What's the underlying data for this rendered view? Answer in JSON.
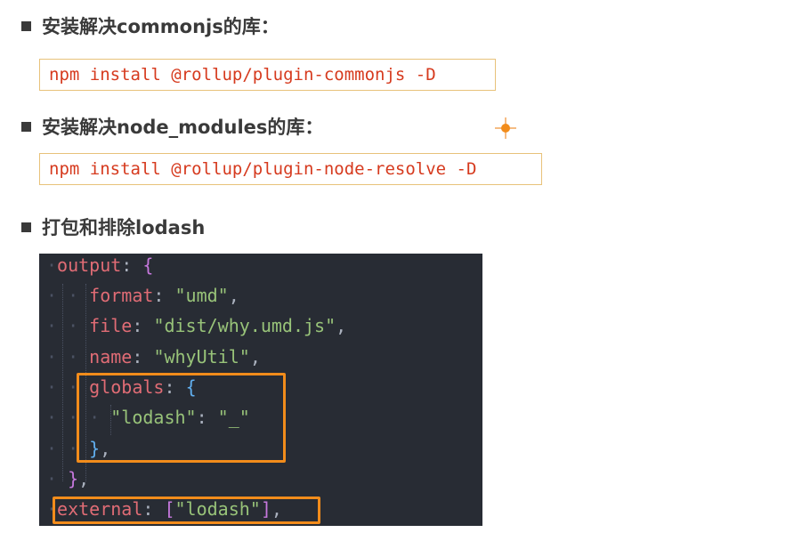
{
  "sections": [
    {
      "heading": "安装解决commonjs的库：",
      "command": "npm install @rollup/plugin-commonjs -D"
    },
    {
      "heading": "安装解决node_modules的库：",
      "command": "npm install @rollup/plugin-node-resolve -D"
    },
    {
      "heading": "打包和排除lodash"
    }
  ],
  "code": {
    "output_key": "output",
    "format_key": "format",
    "format_val": "\"umd\"",
    "file_key": "file",
    "file_val": "\"dist/why.umd.js\"",
    "name_key": "name",
    "name_val": "\"whyUtil\"",
    "globals_key": "globals",
    "lodash_key": "\"lodash\"",
    "lodash_val": "\"_\"",
    "external_key": "external",
    "external_val": "\"lodash\""
  },
  "colors": {
    "command_text": "#d63a1e",
    "command_border": "#e8c27a",
    "code_bg": "#282c34",
    "highlight_box": "#f28c1b",
    "cursor_marker": "#f28c1b"
  }
}
